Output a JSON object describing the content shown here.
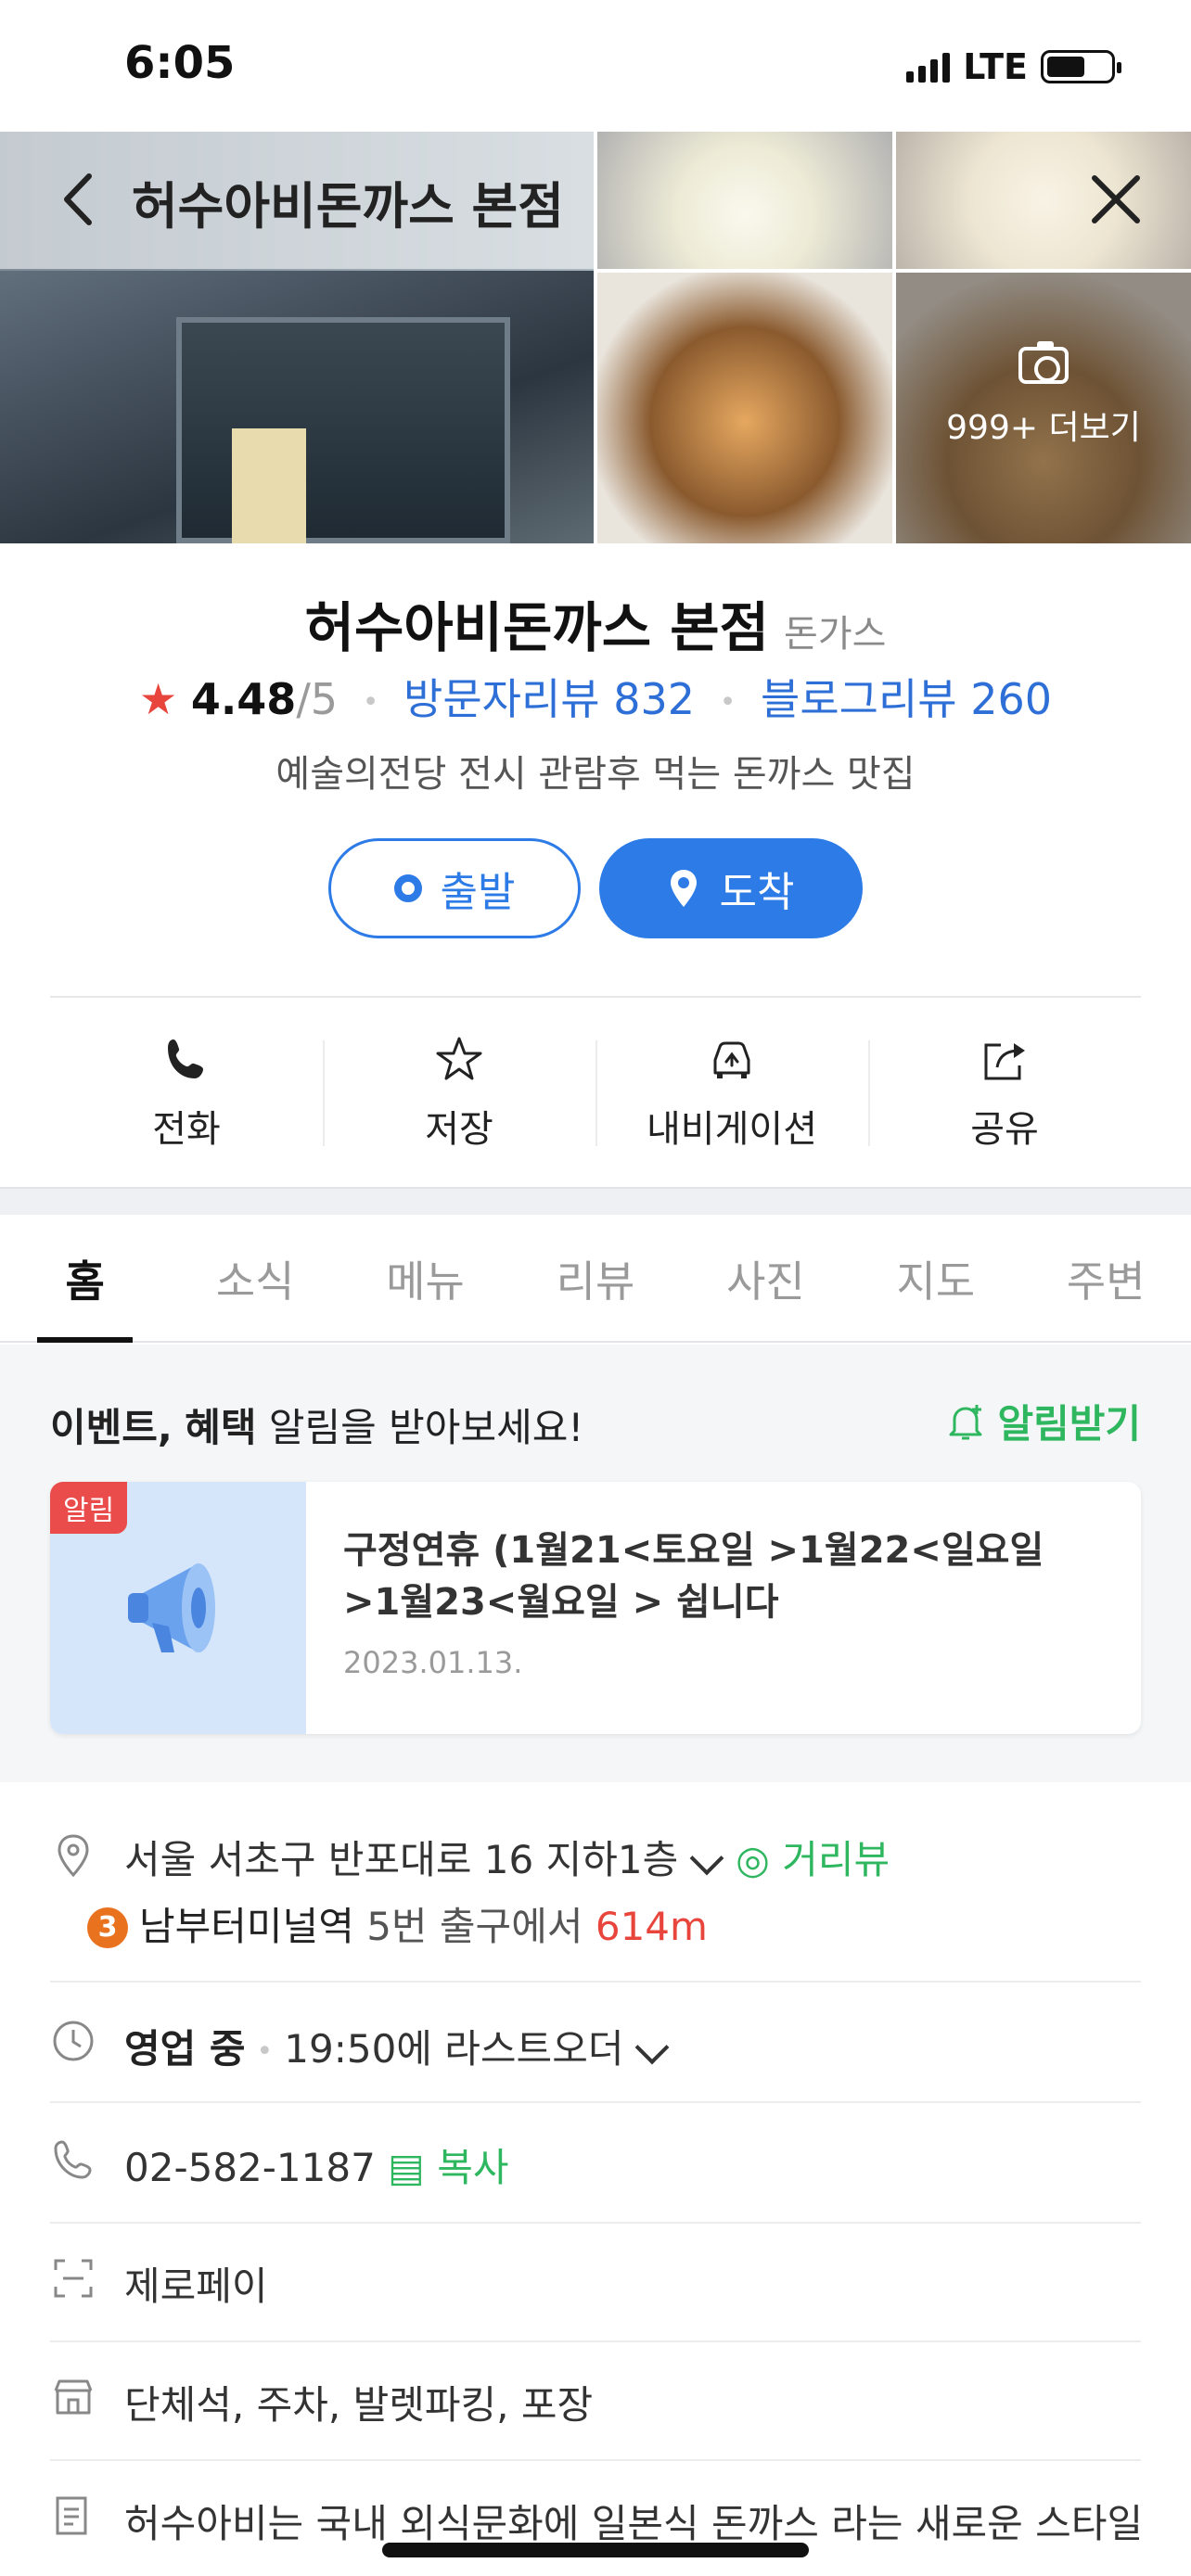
{
  "status_bar": {
    "time": "6:05",
    "network": "LTE"
  },
  "header": {
    "title": "허수아비돈까스 본점"
  },
  "gallery": {
    "more_label": "999+ 더보기"
  },
  "place": {
    "name": "허수아비돈까스 본점",
    "category": "돈가스",
    "rating": "4.48",
    "rating_max": "/5",
    "visitor_reviews": "방문자리뷰 832",
    "blog_reviews": "블로그리뷰 260",
    "description": "예술의전당 전시 관람후 먹는 돈까스 맛집"
  },
  "route_buttons": {
    "start": "출발",
    "arrive": "도착"
  },
  "actions": [
    {
      "label": "전화"
    },
    {
      "label": "저장"
    },
    {
      "label": "내비게이션"
    },
    {
      "label": "공유"
    }
  ],
  "tabs": [
    "홈",
    "소식",
    "메뉴",
    "리뷰",
    "사진",
    "지도",
    "주변"
  ],
  "event": {
    "head_bold_1": "이벤트,",
    "head_bold_2": "혜택",
    "head_rest": "알림을 받아보세요!",
    "alarm_button": "알림받기",
    "card_tag": "알림",
    "card_text": "구정연휴 (1월21<토요일 >1월22<일요일 >1월23<월요일 > 쉽니다",
    "card_date": "2023.01.13."
  },
  "info": {
    "address": "서울 서초구 반포대로 16 지하1층",
    "street_view": "거리뷰",
    "subway_line": "3",
    "subway_station": "남부터미널역",
    "subway_exit": "5번 출구에서",
    "subway_distance": "614m",
    "hours_status": "영업 중",
    "hours_detail": "19:50에 라스트오더",
    "phone": "02-582-1187",
    "copy": "복사",
    "payment": "제로페이",
    "facilities": "단체석, 주차, 발렛파킹, 포장",
    "intro": "허수아비는 국내 외식문화에 일본식 돈까스 라는 새로운 스타일"
  },
  "colors": {
    "accent_blue": "#2d7be6",
    "green": "#2fb760",
    "red": "#e8453c"
  }
}
